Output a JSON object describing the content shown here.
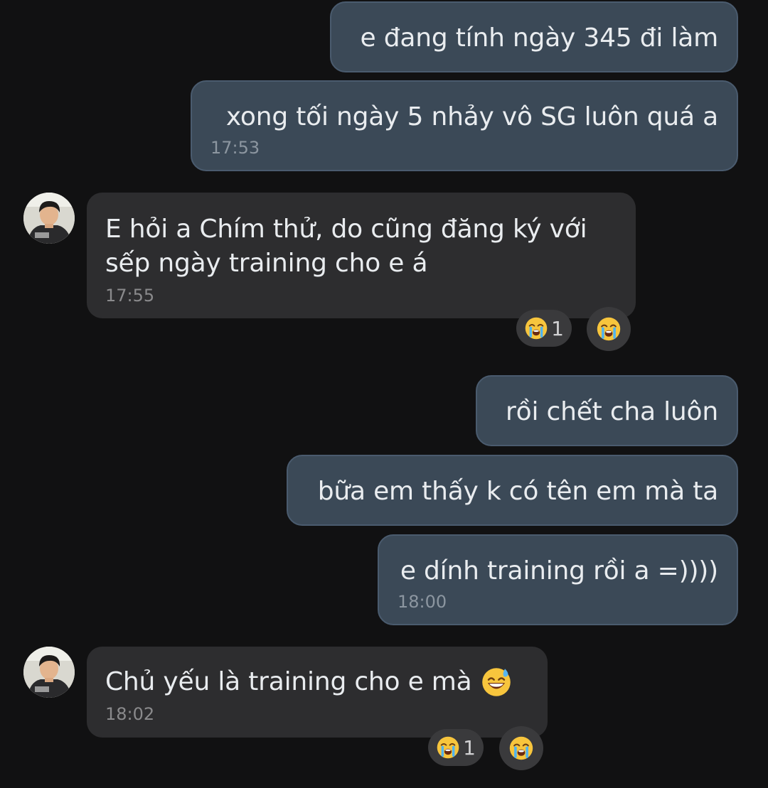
{
  "messages": [
    {
      "text": "e đang tính ngày 345 đi làm"
    },
    {
      "text": "xong tối ngày 5 nhảy vô SG luôn quá a",
      "time": "17:53"
    },
    {
      "text_line1": "E hỏi a Chím thử, do cũng đăng ký với",
      "text_line2": "sếp ngày training cho e á",
      "time": "17:55",
      "reaction_emoji": "loudly-crying-face",
      "reaction_count": "1"
    },
    {
      "text": "rồi chết cha luôn"
    },
    {
      "text": "bữa em thấy k có tên em mà ta"
    },
    {
      "text": "e dính training rồi a =))))",
      "time": "18:00"
    },
    {
      "text": "Chủ yếu là training cho e mà",
      "emoji": "grinning-face-with-sweat",
      "time": "18:02",
      "reaction_emoji": "loudly-crying-face",
      "reaction_count": "1"
    }
  ],
  "colors": {
    "background": "#111112",
    "outgoing_bubble": "#3b4957",
    "outgoing_border": "#4a5b6e",
    "incoming_bubble": "#2d2d2f",
    "text": "#e9ecef",
    "timestamp": "#8c96a0"
  }
}
